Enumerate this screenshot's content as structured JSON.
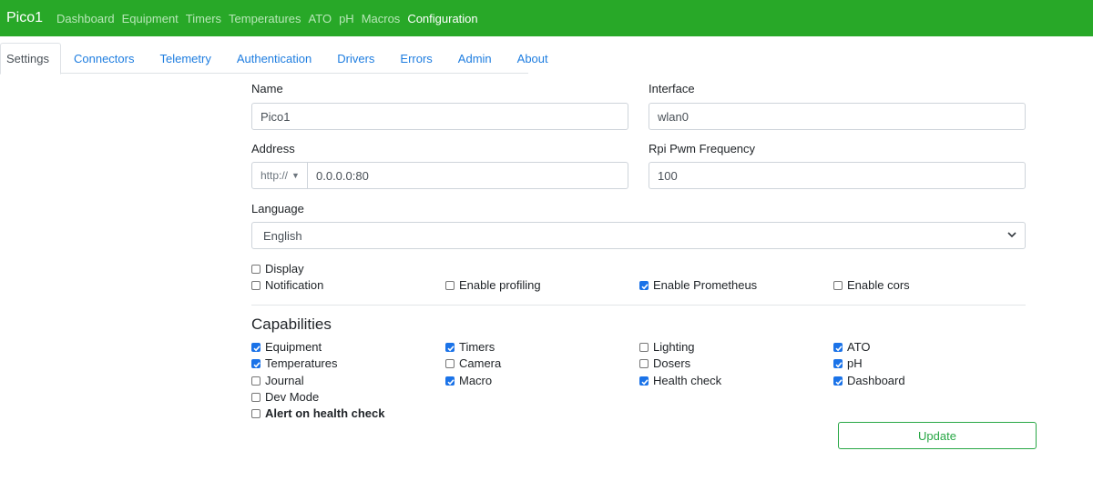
{
  "navbar": {
    "brand": "Pico1",
    "links": [
      "Dashboard",
      "Equipment",
      "Timers",
      "Temperatures",
      "ATO",
      "pH",
      "Macros",
      "Configuration"
    ],
    "active": "Configuration"
  },
  "tabs": [
    "Settings",
    "Connectors",
    "Telemetry",
    "Authentication",
    "Drivers",
    "Errors",
    "Admin",
    "About"
  ],
  "form": {
    "name_label": "Name",
    "name_value": "Pico1",
    "interface_label": "Interface",
    "interface_value": "wlan0",
    "address_label": "Address",
    "address_scheme": "http://",
    "address_value": "0.0.0.0:80",
    "pwm_label": "Rpi Pwm Frequency",
    "pwm_value": "100",
    "language_label": "Language",
    "language_value": "English"
  },
  "options": {
    "display": {
      "label": "Display",
      "checked": false
    },
    "notification": {
      "label": "Notification",
      "checked": false
    },
    "profiling": {
      "label": "Enable profiling",
      "checked": false
    },
    "prometheus": {
      "label": "Enable Prometheus",
      "checked": true
    },
    "cors": {
      "label": "Enable cors",
      "checked": false
    }
  },
  "capabilities_title": "Capabilities",
  "capabilities": {
    "equipment": {
      "label": "Equipment",
      "checked": true
    },
    "timers": {
      "label": "Timers",
      "checked": true
    },
    "lighting": {
      "label": "Lighting",
      "checked": false
    },
    "ato": {
      "label": "ATO",
      "checked": true
    },
    "temperatures": {
      "label": "Temperatures",
      "checked": true
    },
    "camera": {
      "label": "Camera",
      "checked": false
    },
    "dosers": {
      "label": "Dosers",
      "checked": false
    },
    "ph": {
      "label": "pH",
      "checked": true
    },
    "journal": {
      "label": "Journal",
      "checked": false
    },
    "macro": {
      "label": "Macro",
      "checked": true
    },
    "health_check": {
      "label": "Health check",
      "checked": true
    },
    "dashboard": {
      "label": "Dashboard",
      "checked": true
    },
    "dev_mode": {
      "label": "Dev Mode",
      "checked": false
    },
    "alert_health": {
      "label": "Alert on health check",
      "checked": false
    }
  },
  "update_label": "Update",
  "colors": {
    "navbar": "#28a828",
    "link": "#1e7de0",
    "check": "#1b73e8",
    "update": "#28a745"
  }
}
